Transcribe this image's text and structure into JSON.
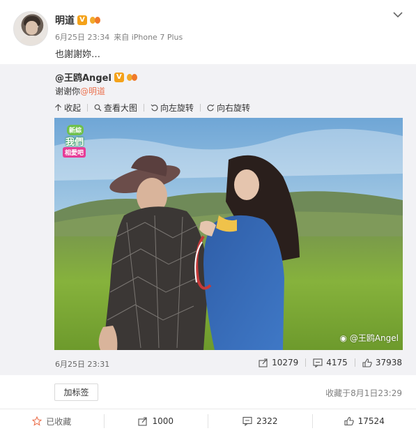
{
  "post": {
    "author": "明道",
    "verified_badge": "V",
    "date": "6月25日 23:34",
    "source": "来自 iPhone 7 Plus",
    "text": "也謝謝妳…",
    "menu_icon": "chevron-down-icon"
  },
  "repost": {
    "author": "@王鸥Angel",
    "verified_badge": "V",
    "text_prefix": "谢谢你",
    "mention": "@明道",
    "toolbar": [
      {
        "icon": "collapse-arrow-icon",
        "label": "收起"
      },
      {
        "icon": "magnifier-icon",
        "label": "查看大图"
      },
      {
        "icon": "rotate-left-icon",
        "label": "向左旋转"
      },
      {
        "icon": "rotate-right-icon",
        "label": "向右旋转"
      }
    ],
    "image_watermark": "@王鸥Angel",
    "sticker": {
      "top": "新綜",
      "middle": "我們",
      "bottom": "相愛吧"
    },
    "time": "6月25日 23:31",
    "stats": {
      "reposts": "10279",
      "comments": "4175",
      "likes": "37938"
    }
  },
  "tag_button": "加标签",
  "favorited_time": "收藏于8月1日23:29",
  "actions": {
    "favorite": "已收藏",
    "repost": "1000",
    "comment": "2322",
    "like": "17524"
  },
  "colors": {
    "mention": "#eb7350",
    "verified": "#f4a21a",
    "repost_bg": "#f2f2f5",
    "favorite_star": "#eb7350"
  }
}
